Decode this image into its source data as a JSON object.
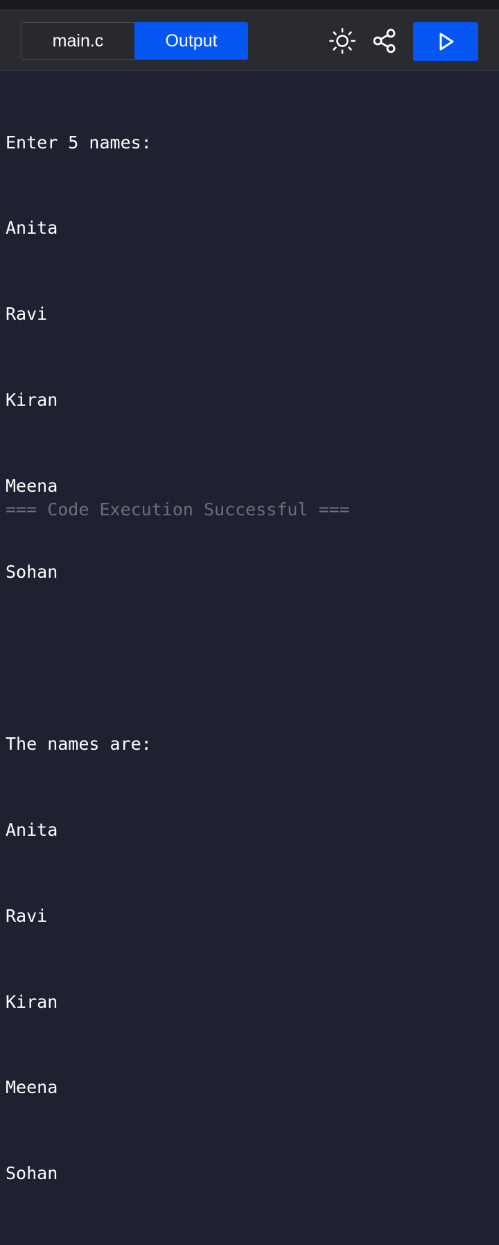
{
  "toolbar": {
    "tabs": [
      {
        "label": "main.c",
        "active": false
      },
      {
        "label": "Output",
        "active": true
      }
    ],
    "theme_icon": "sun-icon",
    "share_icon": "share-icon",
    "run_icon": "play-icon",
    "accent_color": "#0556f3"
  },
  "console": {
    "lines": [
      "Enter 5 names:",
      "Anita",
      "Ravi",
      "Kiran",
      "Meena",
      "Sohan",
      "",
      "The names are:",
      "Anita",
      "Ravi",
      "Kiran",
      "Meena",
      "Sohan"
    ],
    "status": "=== Code Execution Successful ==="
  }
}
